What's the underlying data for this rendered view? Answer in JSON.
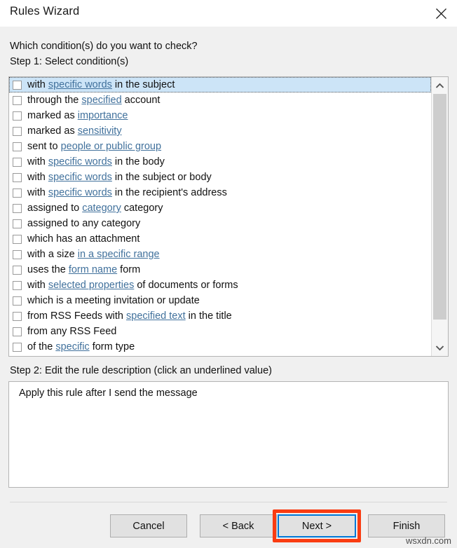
{
  "window": {
    "title": "Rules Wizard",
    "close_icon": "close-icon"
  },
  "body": {
    "question": "Which condition(s) do you want to check?",
    "step1_label": "Step 1: Select condition(s)",
    "step2_label": "Step 2: Edit the rule description (click an underlined value)"
  },
  "conditions": [
    {
      "checked": false,
      "selected": true,
      "parts": [
        {
          "t": "with ",
          "link": false
        },
        {
          "t": "specific words",
          "link": true
        },
        {
          "t": " in the subject",
          "link": false
        }
      ]
    },
    {
      "checked": false,
      "selected": false,
      "parts": [
        {
          "t": "through the ",
          "link": false
        },
        {
          "t": "specified",
          "link": true
        },
        {
          "t": " account",
          "link": false
        }
      ]
    },
    {
      "checked": false,
      "selected": false,
      "parts": [
        {
          "t": "marked as ",
          "link": false
        },
        {
          "t": "importance",
          "link": true
        }
      ]
    },
    {
      "checked": false,
      "selected": false,
      "parts": [
        {
          "t": "marked as ",
          "link": false
        },
        {
          "t": "sensitivity",
          "link": true
        }
      ]
    },
    {
      "checked": false,
      "selected": false,
      "parts": [
        {
          "t": "sent to ",
          "link": false
        },
        {
          "t": "people or public group",
          "link": true
        }
      ]
    },
    {
      "checked": false,
      "selected": false,
      "parts": [
        {
          "t": "with ",
          "link": false
        },
        {
          "t": "specific words",
          "link": true
        },
        {
          "t": " in the body",
          "link": false
        }
      ]
    },
    {
      "checked": false,
      "selected": false,
      "parts": [
        {
          "t": "with ",
          "link": false
        },
        {
          "t": "specific words",
          "link": true
        },
        {
          "t": " in the subject or body",
          "link": false
        }
      ]
    },
    {
      "checked": false,
      "selected": false,
      "parts": [
        {
          "t": "with ",
          "link": false
        },
        {
          "t": "specific words",
          "link": true
        },
        {
          "t": " in the recipient's address",
          "link": false
        }
      ]
    },
    {
      "checked": false,
      "selected": false,
      "parts": [
        {
          "t": "assigned to ",
          "link": false
        },
        {
          "t": "category",
          "link": true
        },
        {
          "t": " category",
          "link": false
        }
      ]
    },
    {
      "checked": false,
      "selected": false,
      "parts": [
        {
          "t": "assigned to any category",
          "link": false
        }
      ]
    },
    {
      "checked": false,
      "selected": false,
      "parts": [
        {
          "t": "which has an attachment",
          "link": false
        }
      ]
    },
    {
      "checked": false,
      "selected": false,
      "parts": [
        {
          "t": "with a size ",
          "link": false
        },
        {
          "t": "in a specific range",
          "link": true
        }
      ]
    },
    {
      "checked": false,
      "selected": false,
      "parts": [
        {
          "t": "uses the ",
          "link": false
        },
        {
          "t": "form name",
          "link": true
        },
        {
          "t": " form",
          "link": false
        }
      ]
    },
    {
      "checked": false,
      "selected": false,
      "parts": [
        {
          "t": "with ",
          "link": false
        },
        {
          "t": "selected properties",
          "link": true
        },
        {
          "t": " of documents or forms",
          "link": false
        }
      ]
    },
    {
      "checked": false,
      "selected": false,
      "parts": [
        {
          "t": "which is a meeting invitation or update",
          "link": false
        }
      ]
    },
    {
      "checked": false,
      "selected": false,
      "parts": [
        {
          "t": "from RSS Feeds with ",
          "link": false
        },
        {
          "t": "specified text",
          "link": true
        },
        {
          "t": " in the title",
          "link": false
        }
      ]
    },
    {
      "checked": false,
      "selected": false,
      "parts": [
        {
          "t": "from any RSS Feed",
          "link": false
        }
      ]
    },
    {
      "checked": false,
      "selected": false,
      "parts": [
        {
          "t": "of the ",
          "link": false
        },
        {
          "t": "specific",
          "link": true
        },
        {
          "t": " form type",
          "link": false
        }
      ]
    }
  ],
  "description": {
    "text": "Apply this rule after I send the message"
  },
  "buttons": {
    "cancel": "Cancel",
    "back": "< Back",
    "next": "Next >",
    "finish": "Finish"
  },
  "highlight": {
    "color": "#fa3c11",
    "target": "next-button"
  },
  "accent": {
    "default_button_border": "#0078d7",
    "link_color": "#41719c",
    "selection_color": "#cce4f7"
  },
  "watermark": {
    "text": "wsxdn.com"
  }
}
